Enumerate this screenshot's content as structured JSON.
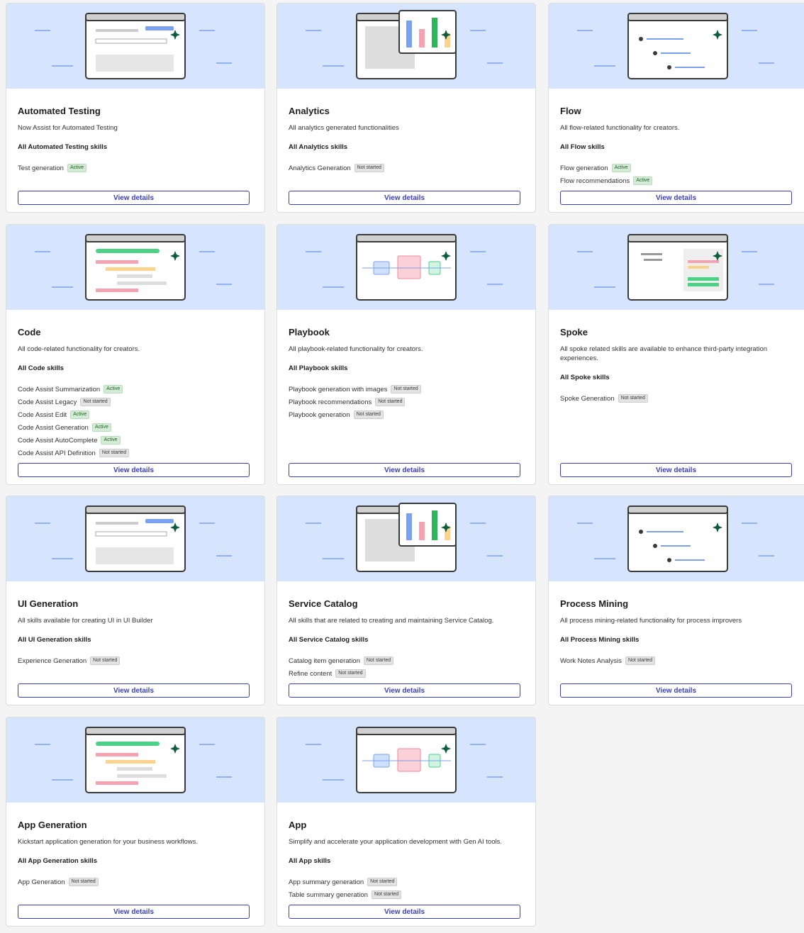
{
  "cards": [
    {
      "title": "Automated Testing",
      "description": "Now Assist for Automated Testing",
      "skills_link": "All Automated Testing skills",
      "skills": [
        {
          "name": "Test generation",
          "status": "Active"
        }
      ],
      "button": "View details"
    },
    {
      "title": "Analytics",
      "description": "All analytics generated functionalities",
      "skills_link": "All Analytics skills",
      "skills": [
        {
          "name": "Analytics Generation",
          "status": "Not started"
        }
      ],
      "button": "View details"
    },
    {
      "title": "Flow",
      "description": "All flow-related functionality for creators.",
      "skills_link": "All Flow skills",
      "skills": [
        {
          "name": "Flow generation",
          "status": "Active"
        },
        {
          "name": "Flow recommendations",
          "status": "Active"
        }
      ],
      "button": "View details"
    },
    {
      "title": "Code",
      "description": "All code-related functionality for creators.",
      "skills_link": "All Code skills",
      "skills": [
        {
          "name": "Code Assist Summarization",
          "status": "Active"
        },
        {
          "name": "Code Assist Legacy",
          "status": "Not started"
        },
        {
          "name": "Code Assist Edit",
          "status": "Active"
        },
        {
          "name": "Code Assist Generation",
          "status": "Active"
        },
        {
          "name": "Code Assist AutoComplete",
          "status": "Active"
        },
        {
          "name": "Code Assist API Definition",
          "status": "Not started"
        }
      ],
      "button": "View details"
    },
    {
      "title": "Playbook",
      "description": "All playbook-related functionality for creators.",
      "skills_link": "All Playbook skills",
      "skills": [
        {
          "name": "Playbook generation with images",
          "status": "Not started"
        },
        {
          "name": "Playbook recommendations",
          "status": "Not started"
        },
        {
          "name": "Playbook generation",
          "status": "Not started"
        }
      ],
      "button": "View details"
    },
    {
      "title": "Spoke",
      "description": "All spoke related skills are available to enhance third-party integration experiences.",
      "skills_link": "All Spoke skills",
      "skills": [
        {
          "name": "Spoke Generation",
          "status": "Not started"
        }
      ],
      "button": "View details"
    },
    {
      "title": "UI Generation",
      "description": "All skills available for creating UI in UI Builder",
      "skills_link": "All UI Generation skills",
      "skills": [
        {
          "name": "Experience Generation",
          "status": "Not started"
        }
      ],
      "button": "View details"
    },
    {
      "title": "Service Catalog",
      "description": "All skills that are related to creating and maintaining Service Catalog.",
      "skills_link": "All Service Catalog skills",
      "skills": [
        {
          "name": "Catalog item generation",
          "status": "Not started"
        },
        {
          "name": "Refine content",
          "status": "Not started"
        }
      ],
      "button": "View details"
    },
    {
      "title": "Process Mining",
      "description": "All process mining-related functionality for process improvers",
      "skills_link": "All Process Mining skills",
      "skills": [
        {
          "name": "Work Notes Analysis",
          "status": "Not started"
        }
      ],
      "button": "View details"
    },
    {
      "title": "App Generation",
      "description": "Kickstart application generation for your business workflows.",
      "skills_link": "All App Generation skills",
      "skills": [
        {
          "name": "App Generation",
          "status": "Not started"
        }
      ],
      "button": "View details"
    },
    {
      "title": "App",
      "description": "Simplify and accelerate your application development with Gen AI tools.",
      "skills_link": "All App skills",
      "skills": [
        {
          "name": "App summary generation",
          "status": "Not started"
        },
        {
          "name": "Table summary generation",
          "status": "Not started"
        }
      ],
      "button": "View details"
    }
  ]
}
